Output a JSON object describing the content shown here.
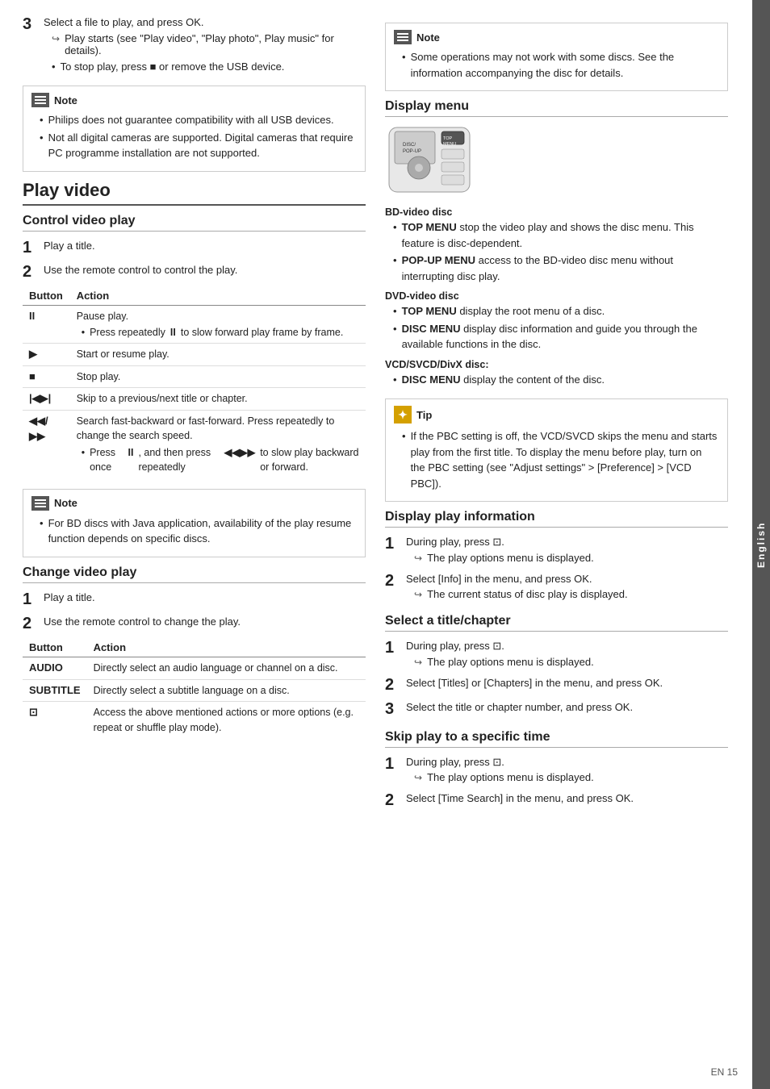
{
  "page": {
    "footer": "EN  15",
    "side_tab": "English"
  },
  "left": {
    "step3": {
      "num": "3",
      "text": "Select a file to play, and press OK.",
      "arrow1": "Play starts (see \"Play video\", \"Play photo\", Play music\" for details).",
      "bullet1": "To stop play, press ■ or remove the USB device."
    },
    "note1": {
      "title": "Note",
      "items": [
        "Philips does not guarantee compatibility with all USB devices.",
        "Not all digital cameras are supported. Digital cameras that require PC programme installation are not supported."
      ]
    },
    "play_video": {
      "title": "Play video",
      "control_title": "Control video play",
      "step1": {
        "num": "1",
        "text": "Play a title."
      },
      "step2": {
        "num": "2",
        "text": "Use the remote control to control the play."
      },
      "table": {
        "col1": "Button",
        "col2": "Action",
        "rows": [
          {
            "button": "II",
            "action": "Pause play.",
            "sub": "Press repeatedly II to slow forward play frame by frame."
          },
          {
            "button": "▶",
            "action": "Start or resume play.",
            "sub": ""
          },
          {
            "button": "■",
            "action": "Stop play.",
            "sub": ""
          },
          {
            "button": "|◀▶|",
            "action": "Skip to a previous/next title or chapter.",
            "sub": ""
          },
          {
            "button": "◀◀/▶▶",
            "action": "Search fast-backward or fast-forward. Press repeatedly to change the search speed.",
            "sub": "Press once II, and then press repeatedly ◀◀▶▶ to slow play backward or forward."
          }
        ]
      }
    },
    "note2": {
      "title": "Note",
      "items": [
        "For BD discs with Java application, availability of the play resume function depends on specific discs."
      ]
    },
    "change_video": {
      "title": "Change video play",
      "step1": {
        "num": "1",
        "text": "Play a title."
      },
      "step2": {
        "num": "2",
        "text": "Use the remote control to change the play."
      },
      "table": {
        "col1": "Button",
        "col2": "Action",
        "rows": [
          {
            "button": "AUDIO",
            "action": "Directly select an audio language or channel on a disc.",
            "sub": ""
          },
          {
            "button": "SUBTITLE",
            "action": "Directly select a subtitle language on a disc.",
            "sub": ""
          },
          {
            "button": "⊡",
            "action": "Access the above mentioned actions or more options (e.g. repeat or shuffle play mode).",
            "sub": ""
          }
        ]
      }
    }
  },
  "right": {
    "note_top": {
      "title": "Note",
      "items": [
        "Some operations may not work with some discs. See the information accompanying the disc for details."
      ]
    },
    "display_menu": {
      "title": "Display menu",
      "bd_label": "BD-video disc",
      "bd_items": [
        "TOP MENU stop the video play and shows the disc menu. This feature is disc-dependent.",
        "POP-UP MENU access to the BD-video disc menu without interrupting disc play."
      ],
      "dvd_label": "DVD-video disc",
      "dvd_items": [
        "TOP MENU display the root menu of a disc.",
        "DISC MENU display disc information and guide you through the available functions in the disc."
      ],
      "vcd_label": "VCD/SVCD/DivX disc:",
      "vcd_items": [
        "DISC MENU display the content of the disc."
      ]
    },
    "tip": {
      "title": "Tip",
      "text": "If the PBC setting is off, the VCD/SVCD skips the menu and starts play from the first title. To display the menu before play, turn on the PBC setting (see \"Adjust settings\" > [Preference] > [VCD PBC])."
    },
    "display_play_info": {
      "title": "Display play information",
      "step1": {
        "num": "1",
        "text": "During play, press ⊡.",
        "arrow": "The play options menu is displayed."
      },
      "step2": {
        "num": "2",
        "text": "Select [Info] in the menu, and press OK.",
        "arrow": "The current status of disc play is displayed."
      }
    },
    "select_title": {
      "title": "Select a title/chapter",
      "step1": {
        "num": "1",
        "text": "During play, press ⊡.",
        "arrow": "The play options menu is displayed."
      },
      "step2": {
        "num": "2",
        "text": "Select [Titles] or [Chapters] in the menu, and press OK.",
        "arrow": ""
      },
      "step3": {
        "num": "3",
        "text": "Select the title or chapter number, and press OK.",
        "arrow": ""
      }
    },
    "skip_play": {
      "title": "Skip play to a specific time",
      "step1": {
        "num": "1",
        "text": "During play, press ⊡.",
        "arrow": "The play options menu is displayed."
      },
      "step2": {
        "num": "2",
        "text": "Select [Time Search] in the menu, and press OK.",
        "arrow": ""
      }
    }
  }
}
